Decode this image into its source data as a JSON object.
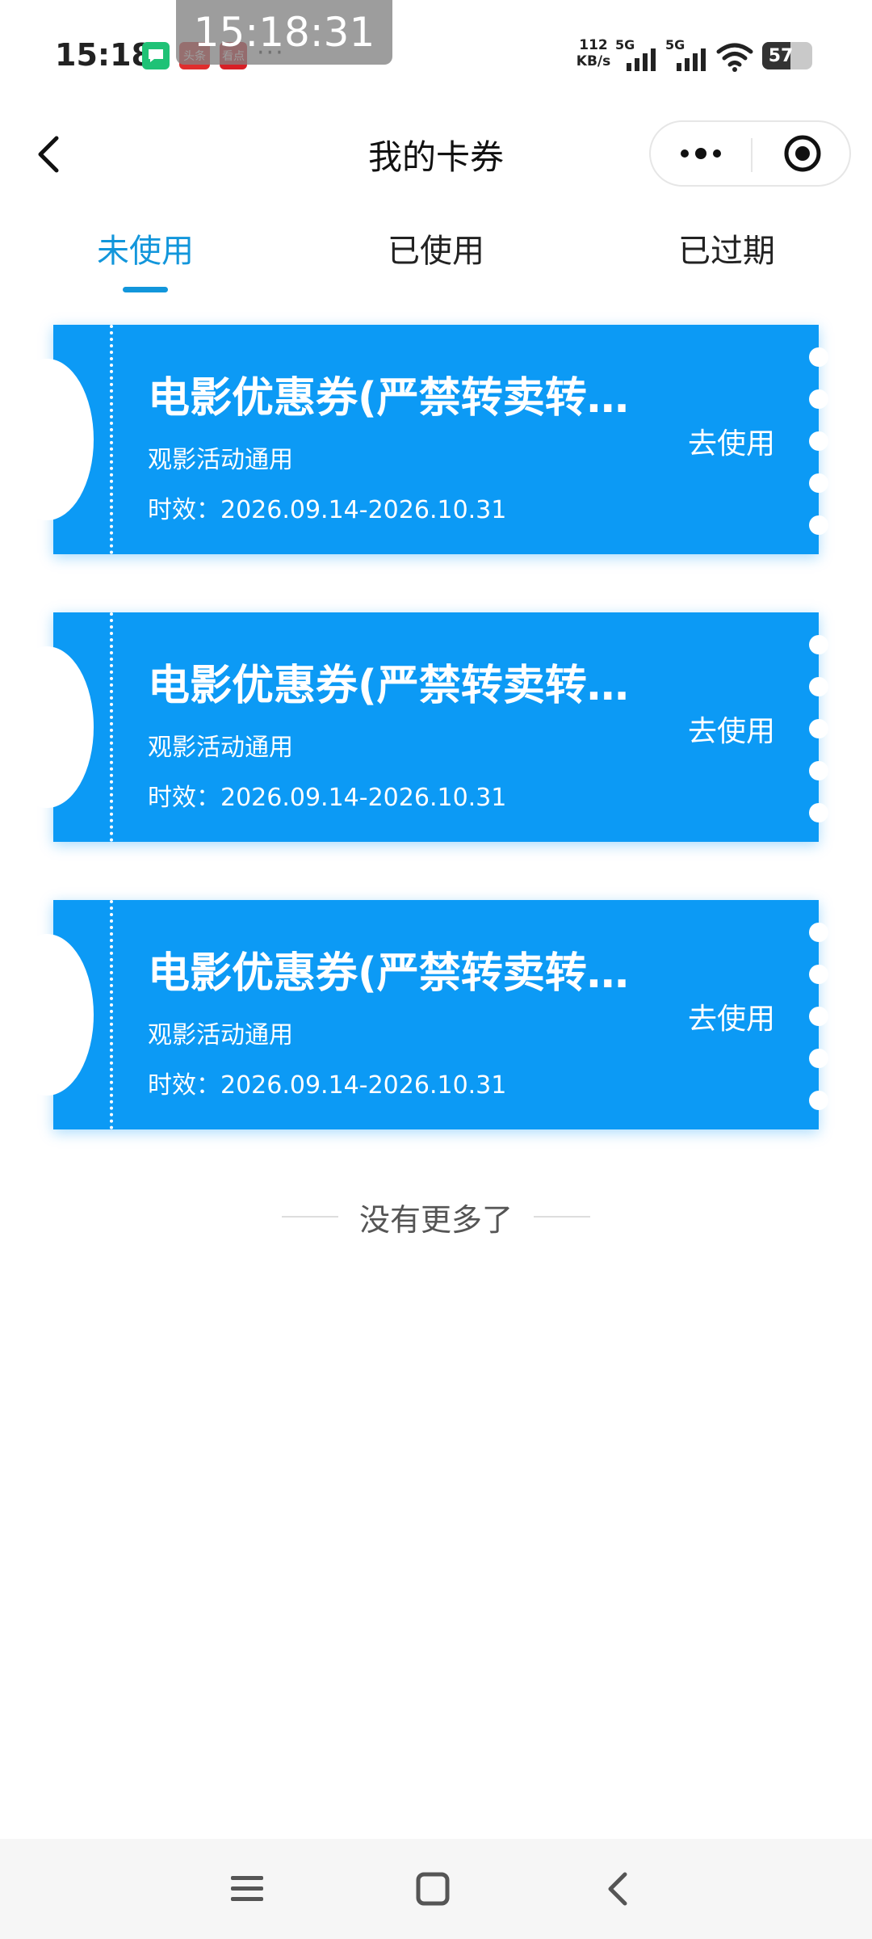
{
  "status_bar": {
    "time": "15:18",
    "overlay_time": "15:18:31",
    "notifications": {
      "app2_label": "头条",
      "app3_label": "看点",
      "more": "···"
    },
    "net_speed_value": "112",
    "net_speed_unit": "KB/s",
    "signal1_label": "5G",
    "signal2_label": "5G",
    "battery_percent": "57",
    "battery_level": 0.57
  },
  "nav": {
    "title": "我的卡券"
  },
  "tabs": [
    {
      "label": "未使用",
      "active": true
    },
    {
      "label": "已使用",
      "active": false
    },
    {
      "label": "已过期",
      "active": false
    }
  ],
  "coupons": [
    {
      "title": "电影优惠券(严禁转卖转赠)",
      "desc": "观影活动通用",
      "validity": "时效：2026.09.14-2026.10.31",
      "action": "去使用"
    },
    {
      "title": "电影优惠券(严禁转卖转赠)",
      "desc": "观影活动通用",
      "validity": "时效：2026.09.14-2026.10.31",
      "action": "去使用"
    },
    {
      "title": "电影优惠券(严禁转卖转赠)",
      "desc": "观影活动通用",
      "validity": "时效：2026.09.14-2026.10.31",
      "action": "去使用"
    }
  ],
  "footer": {
    "no_more": "没有更多了"
  },
  "colors": {
    "accent": "#1296db",
    "coupon_bg": "#0c9af5"
  },
  "icons": {
    "back": "chevron-left-icon",
    "more": "more-dots-icon",
    "close": "target-close-icon",
    "sys_menu": "menu-icon",
    "sys_home": "home-square-icon",
    "sys_back": "chevron-left-icon"
  }
}
